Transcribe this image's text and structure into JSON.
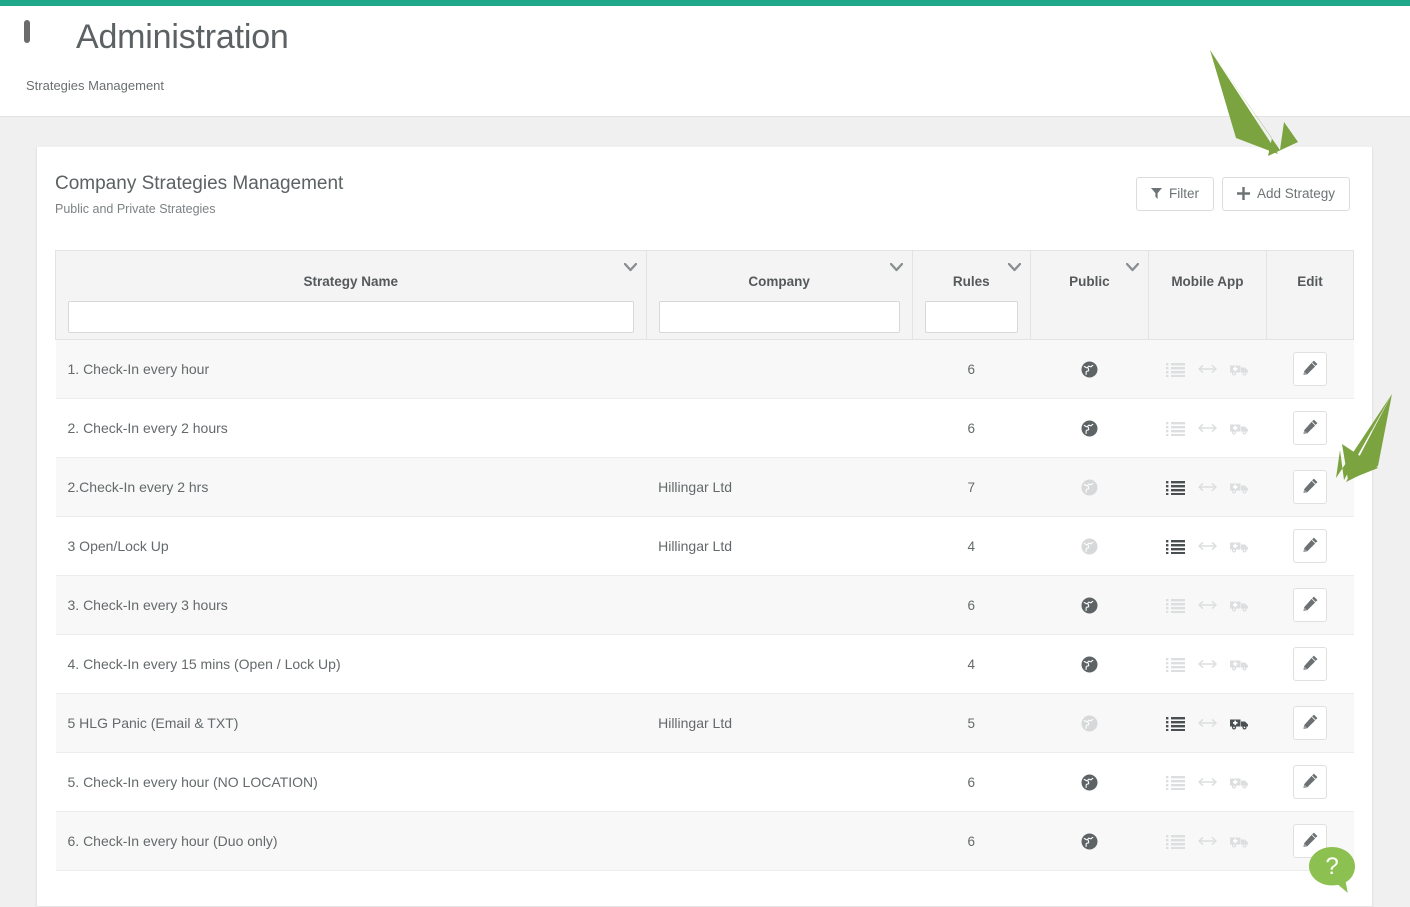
{
  "theme": {
    "accent_bar": "#1fa98a",
    "annotation_arrow": "#7ba440",
    "help_bubble": "#8cc152",
    "page_background": "#f0f0f0"
  },
  "header": {
    "icon": "monitor-icon",
    "title": "Administration",
    "subtitle": "Strategies Management"
  },
  "card": {
    "title": "Company Strategies Management",
    "subtitle": "Public and Private Strategies",
    "filter_button": {
      "label": "Filter",
      "icon": "funnel-icon"
    },
    "add_button": {
      "label": "Add Strategy",
      "icon": "plus-icon"
    }
  },
  "table": {
    "columns": [
      {
        "key": "strategy_name",
        "label": "Strategy Name",
        "sortable": true,
        "has_filter": true,
        "filter_value": ""
      },
      {
        "key": "company",
        "label": "Company",
        "sortable": true,
        "has_filter": true,
        "filter_value": ""
      },
      {
        "key": "rules",
        "label": "Rules",
        "sortable": true,
        "has_filter": true,
        "filter_value": ""
      },
      {
        "key": "public",
        "label": "Public",
        "sortable": true,
        "has_filter": false,
        "filter_value": ""
      },
      {
        "key": "mobile_app",
        "label": "Mobile App",
        "sortable": false,
        "has_filter": false,
        "filter_value": ""
      },
      {
        "key": "edit",
        "label": "Edit",
        "sortable": false,
        "has_filter": false,
        "filter_value": ""
      }
    ],
    "rows": [
      {
        "strategy_name": "1. Check-In every hour",
        "company": "",
        "rules": "6",
        "public": true,
        "mobile": {
          "list": false,
          "arrows": false,
          "ambulance": false
        },
        "edit_icon": "pencil-icon"
      },
      {
        "strategy_name": "2. Check-In every 2 hours",
        "company": "",
        "rules": "6",
        "public": true,
        "mobile": {
          "list": false,
          "arrows": false,
          "ambulance": false
        },
        "edit_icon": "pencil-icon"
      },
      {
        "strategy_name": "2.Check-In every 2 hrs",
        "company": "Hillingar Ltd",
        "rules": "7",
        "public": false,
        "mobile": {
          "list": true,
          "arrows": false,
          "ambulance": false
        },
        "edit_icon": "pencil-icon"
      },
      {
        "strategy_name": "3 Open/Lock Up",
        "company": "Hillingar Ltd",
        "rules": "4",
        "public": false,
        "mobile": {
          "list": true,
          "arrows": false,
          "ambulance": false
        },
        "edit_icon": "pencil-icon"
      },
      {
        "strategy_name": "3. Check-In every 3 hours",
        "company": "",
        "rules": "6",
        "public": true,
        "mobile": {
          "list": false,
          "arrows": false,
          "ambulance": false
        },
        "edit_icon": "pencil-icon"
      },
      {
        "strategy_name": "4. Check-In every 15 mins (Open / Lock Up)",
        "company": "",
        "rules": "4",
        "public": true,
        "mobile": {
          "list": false,
          "arrows": false,
          "ambulance": false
        },
        "edit_icon": "pencil-icon"
      },
      {
        "strategy_name": "5 HLG Panic (Email & TXT)",
        "company": "Hillingar Ltd",
        "rules": "5",
        "public": false,
        "mobile": {
          "list": true,
          "arrows": false,
          "ambulance": true
        },
        "edit_icon": "pencil-icon"
      },
      {
        "strategy_name": "5. Check-In every hour (NO LOCATION)",
        "company": "",
        "rules": "6",
        "public": true,
        "mobile": {
          "list": false,
          "arrows": false,
          "ambulance": false
        },
        "edit_icon": "pencil-icon"
      },
      {
        "strategy_name": "6. Check-In every hour (Duo only)",
        "company": "",
        "rules": "6",
        "public": true,
        "mobile": {
          "list": false,
          "arrows": false,
          "ambulance": false
        },
        "edit_icon": "pencil-icon"
      }
    ]
  },
  "annotations": [
    {
      "name": "arrow-to-add-strategy",
      "direction": "down-right"
    },
    {
      "name": "arrow-to-edit-row",
      "direction": "down-left"
    }
  ],
  "help": {
    "icon": "question-mark-icon",
    "label": "?"
  }
}
